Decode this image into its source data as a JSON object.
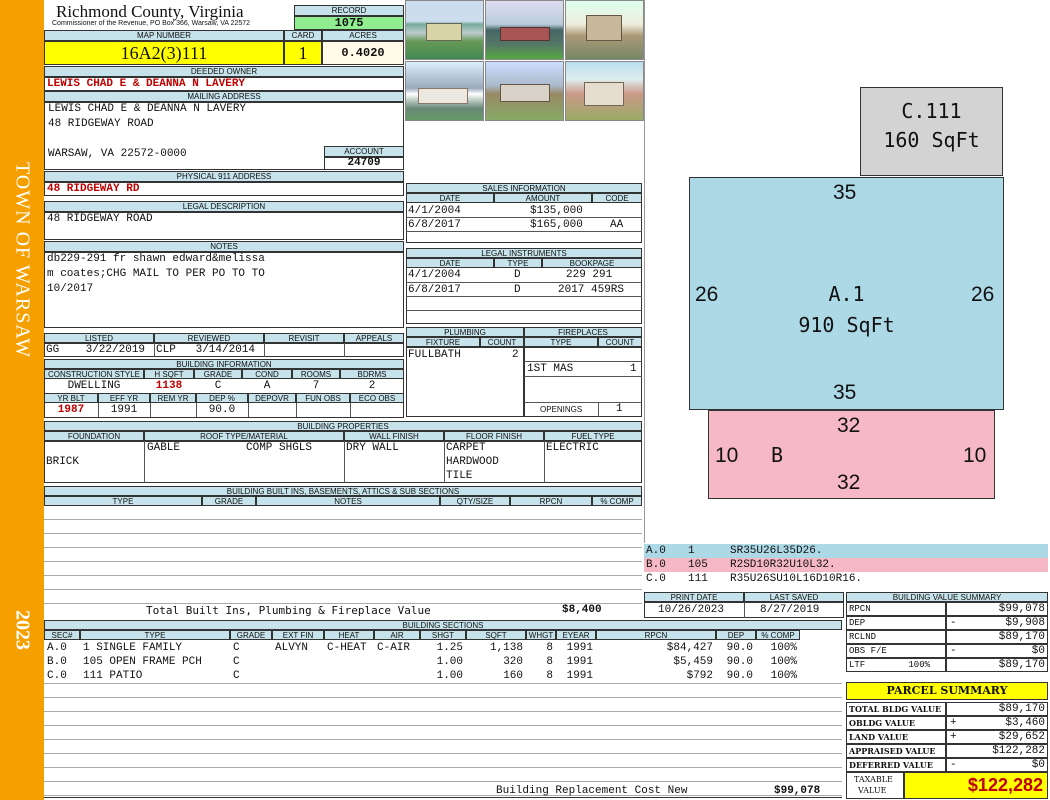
{
  "sidebar": {
    "town": "TOWN OF WARSAW",
    "year": "2023"
  },
  "header": {
    "county": "Richmond County, Virginia",
    "address": "Commissioner of the Revenue, PO Box 366, Warsaw, VA 22572",
    "record_label": "RECORD",
    "record": "1075",
    "map_label": "MAP NUMBER",
    "map_number": "16A2(3)111",
    "card_label": "CARD",
    "card": "1",
    "acres_label": "ACRES",
    "acres": "0.4020"
  },
  "owner": {
    "label": "DEEDED OWNER",
    "name": "LEWIS CHAD E & DEANNA N LAVERY",
    "mail_label": "MAILING ADDRESS",
    "mail1": "LEWIS CHAD E & DEANNA N LAVERY",
    "mail2": "48 RIDGEWAY ROAD",
    "mail3": "WARSAW, VA 22572-0000",
    "account_label": "ACCOUNT",
    "account": "24709",
    "phys_label": "PHYSICAL 911 ADDRESS",
    "phys": "48 RIDGEWAY RD",
    "legal_label": "LEGAL DESCRIPTION",
    "legal": "48 RIDGEWAY ROAD",
    "notes_label": "NOTES",
    "notes": [
      "db229-291 fr shawn edward&melissa",
      "m coates;CHG MAIL TO PER PO TO TO",
      "10/2017"
    ]
  },
  "sales": {
    "label": "SALES INFORMATION",
    "cols": [
      "DATE",
      "AMOUNT",
      "CODE"
    ],
    "rows": [
      [
        "4/1/2004",
        "$135,000",
        ""
      ],
      [
        "6/8/2017",
        "$165,000",
        "AA"
      ]
    ]
  },
  "legal_inst": {
    "label": "LEGAL INSTRUMENTS",
    "cols": [
      "DATE",
      "TYPE",
      "BOOKPAGE"
    ],
    "rows": [
      [
        "4/1/2004",
        "D",
        "229 291"
      ],
      [
        "6/8/2017",
        "D",
        "2017 459RS"
      ]
    ]
  },
  "listing": {
    "listed_label": "LISTED",
    "listed": "GG    3/22/2019",
    "reviewed_label": "REVIEWED",
    "reviewed": "CLP   3/14/2014",
    "revisit_label": "REVISIT",
    "appeals_label": "APPEALS"
  },
  "building_info": {
    "label": "BUILDING INFORMATION",
    "cols": [
      "CONSTRUCTION STYLE",
      "H SQFT",
      "GRADE",
      "COND",
      "ROOMS",
      "BDRMS"
    ],
    "vals": [
      "DWELLING",
      "1138",
      "C",
      "A",
      "7",
      "2"
    ],
    "cols2": [
      "YR BLT",
      "EFF YR",
      "REM YR",
      "DEP %",
      "DEPOVR",
      "FUN OBS",
      "ECO OBS"
    ],
    "vals2": [
      "1987",
      "1991",
      "",
      "90.0",
      "",
      "",
      ""
    ]
  },
  "plumbing": {
    "label": "PLUMBING",
    "cols": [
      "FIXTURE",
      "COUNT"
    ],
    "fixture": "FULLBATH",
    "count": "2"
  },
  "fireplaces": {
    "label": "FIREPLACES",
    "cols": [
      "TYPE",
      "COUNT"
    ],
    "type": "1ST MAS",
    "count": "1",
    "openings_label": "OPENINGS",
    "openings": "1"
  },
  "props": {
    "label": "BUILDING PROPERTIES",
    "cols": [
      "FOUNDATION",
      "ROOF TYPE/MATERIAL",
      "WALL FINISH",
      "FLOOR FINISH",
      "FUEL TYPE"
    ],
    "foundation": "BRICK",
    "roof_type": "GABLE",
    "roof_mat": "COMP SHGLS",
    "wall": "DRY WALL",
    "floor": [
      "CARPET",
      "HARDWOOD",
      "TILE"
    ],
    "fuel": "ELECTRIC"
  },
  "builtins": {
    "label": "BUILDING BUILT INS, BASEMENTS, ATTICS & SUB SECTIONS",
    "cols": [
      "TYPE",
      "GRADE",
      "NOTES",
      "QTY/SIZE",
      "RPCN",
      "% COMP"
    ],
    "total_label": "Total Built Ins, Plumbing & Fireplace Value",
    "total": "$8,400"
  },
  "sections": {
    "label": "BUILDING SECTIONS",
    "cols": [
      "SEC#",
      "TYPE",
      "GRADE",
      "EXT FIN",
      "HEAT",
      "AIR",
      "SHGT",
      "SQFT",
      "WHGT",
      "EYEAR",
      "RPCN",
      "DEP",
      "% COMP"
    ],
    "rows": [
      [
        "A.0",
        "1 SINGLE FAMILY",
        "C",
        "ALVYN",
        "C-HEAT",
        "C-AIR",
        "1.25",
        "1,138",
        "8",
        "1991",
        "$84,427",
        "90.0",
        "100%"
      ],
      [
        "B.0",
        "105 OPEN FRAME PCH",
        "C",
        "",
        "",
        "",
        "1.00",
        "320",
        "8",
        "1991",
        "$5,459",
        "90.0",
        "100%"
      ],
      [
        "C.0",
        "111 PATIO",
        "C",
        "",
        "",
        "",
        "1.00",
        "160",
        "8",
        "1991",
        "$792",
        "90.0",
        "100%"
      ]
    ],
    "replacement_label": "Building Replacement Cost New",
    "replacement": "$99,078"
  },
  "sketch": {
    "c_label": "C.111",
    "c_area": "160 SqFt",
    "a_label": "A.1",
    "a_area": "910 SqFt",
    "a_top": "35",
    "a_bottom": "35",
    "a_left": "26",
    "a_right": "26",
    "b_label": "B",
    "b_top": "32",
    "b_bottom": "32",
    "b_left": "10",
    "b_right": "10",
    "legend": [
      [
        "A.0",
        "1",
        "SR35U26L35D26."
      ],
      [
        "B.0",
        "105",
        "R2SD10R32U10L32."
      ],
      [
        "C.0",
        "111",
        "R35U26SU10L16D10R16."
      ]
    ],
    "colors": {
      "a": "#add8e6",
      "b": "#f5b8c4",
      "c": "#d3d3d3"
    }
  },
  "dates": {
    "print_label": "PRINT DATE",
    "print": "10/26/2023",
    "saved_label": "LAST SAVED",
    "saved": "8/27/2019"
  },
  "value_summary": {
    "label": "BUILDING VALUE SUMMARY",
    "rows": [
      [
        "RPCN",
        "",
        "$99,078"
      ],
      [
        "DEP",
        "-",
        "$9,908"
      ],
      [
        "RCLND",
        "",
        "$89,170"
      ],
      [
        "OBS F/E",
        "-",
        "$0"
      ],
      [
        "LTF        100%",
        "",
        "$89,170"
      ]
    ]
  },
  "parcel": {
    "label": "PARCEL SUMMARY",
    "rows": [
      [
        "TOTAL BLDG VALUE",
        "",
        "$89,170"
      ],
      [
        "OBLDG VALUE",
        "+",
        "$3,460"
      ],
      [
        "LAND VALUE",
        "+",
        "$29,652"
      ],
      [
        "APPRAISED VALUE",
        "",
        "$122,282"
      ],
      [
        "DEFERRED VALUE",
        "-",
        "$0"
      ]
    ],
    "taxable_label1": "TAXABLE",
    "taxable_label2": "VALUE",
    "taxable": "$122,282"
  }
}
